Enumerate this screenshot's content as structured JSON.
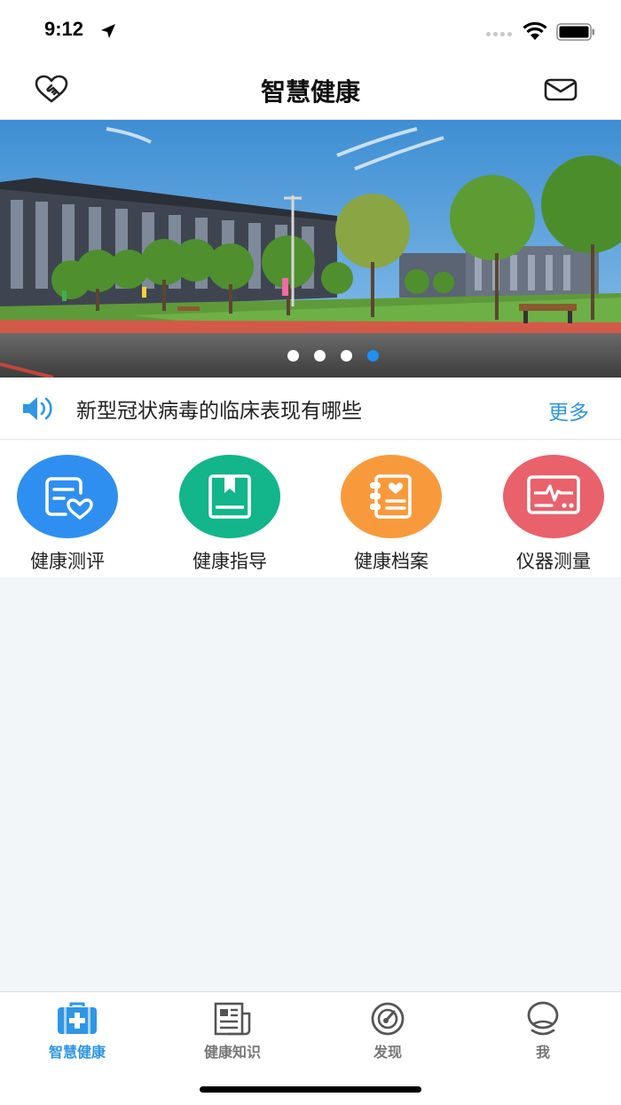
{
  "status_bar": {
    "time": "9:12"
  },
  "nav": {
    "title": "智慧健康"
  },
  "banner": {
    "slide_count": 4,
    "active_slide": 4
  },
  "news": {
    "headline": "新型冠状病毒的临床表现有哪些",
    "more_label": "更多"
  },
  "features": [
    {
      "label": "健康测评",
      "icon": "health-assessment-icon",
      "color": "#2f8ff0"
    },
    {
      "label": "健康指导",
      "icon": "health-guide-book-icon",
      "color": "#13b58a"
    },
    {
      "label": "健康档案",
      "icon": "health-record-icon",
      "color": "#f89a3c"
    },
    {
      "label": "仪器测量",
      "icon": "device-measure-icon",
      "color": "#e9616b"
    }
  ],
  "tabs": [
    {
      "label": "智慧健康",
      "icon": "medical-kit-icon",
      "active": true
    },
    {
      "label": "健康知识",
      "icon": "newspaper-icon",
      "active": false
    },
    {
      "label": "发现",
      "icon": "compass-icon",
      "active": false
    },
    {
      "label": "我",
      "icon": "user-icon",
      "active": false
    }
  ],
  "colors": {
    "accent": "#2e96e6",
    "background": "#f3f6f9"
  }
}
